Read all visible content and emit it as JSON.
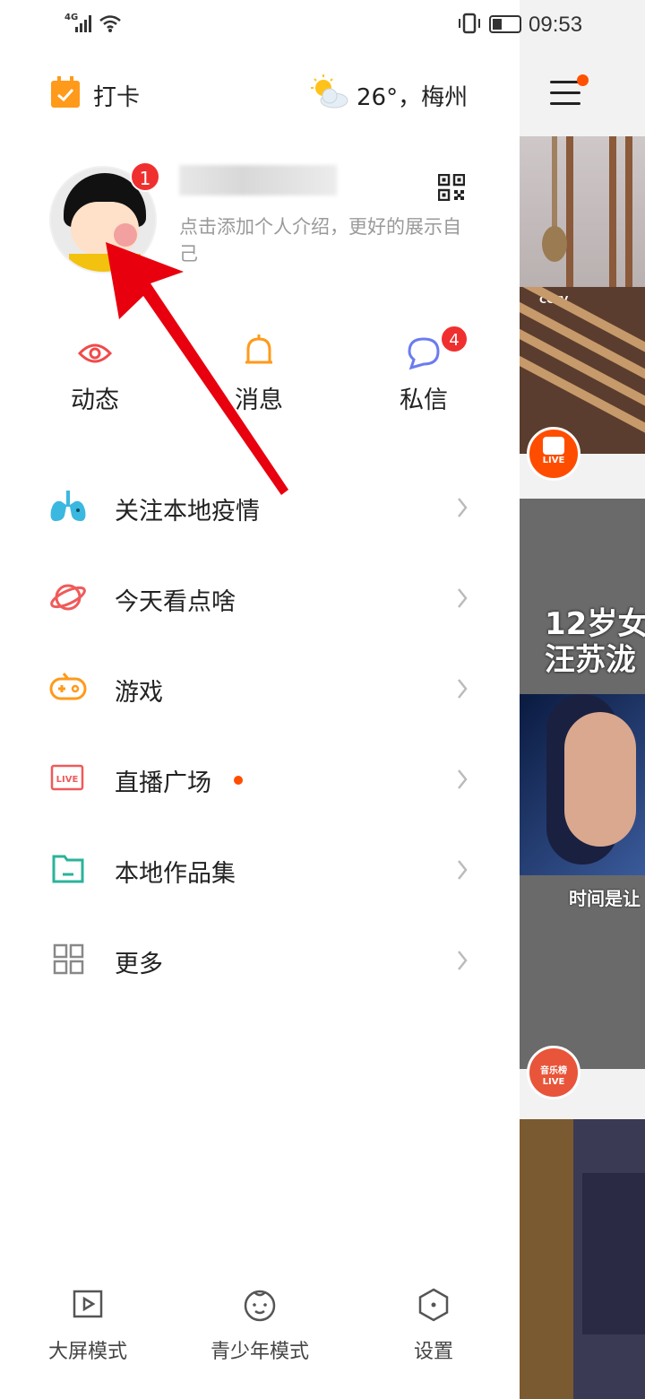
{
  "status_bar": {
    "network": "4G",
    "time": "09:53"
  },
  "top": {
    "checkin_label": "打卡",
    "weather_text": "26°，梅州"
  },
  "profile": {
    "avatar_badge": "1",
    "bio": "点击添加个人介绍，更好的展示自己"
  },
  "quick_actions": [
    {
      "label": "动态",
      "icon": "eye-icon",
      "color": "#f04a4a"
    },
    {
      "label": "消息",
      "icon": "bell-icon",
      "color": "#ff9a1a"
    },
    {
      "label": "私信",
      "icon": "chat-bubble-icon",
      "color": "#6b7cf0",
      "badge": "4"
    }
  ],
  "menu": [
    {
      "label": "关注本地疫情",
      "icon": "lungs-icon",
      "color": "#3ab8e0"
    },
    {
      "label": "今天看点啥",
      "icon": "planet-icon",
      "color": "#f05a5a"
    },
    {
      "label": "游戏",
      "icon": "gamepad-icon",
      "color": "#ff9a1a"
    },
    {
      "label": "直播广场",
      "icon": "live-icon",
      "color": "#f05a5a",
      "has_dot": true
    },
    {
      "label": "本地作品集",
      "icon": "folder-icon",
      "color": "#2bb39a"
    },
    {
      "label": "更多",
      "icon": "grid-icon",
      "color": "#888888"
    }
  ],
  "bottom": [
    {
      "label": "大屏模式",
      "icon": "play-screen-icon"
    },
    {
      "label": "青少年模式",
      "icon": "child-face-icon"
    },
    {
      "label": "设置",
      "icon": "hexagon-settings-icon"
    }
  ],
  "feed": {
    "card2_tag": "CCTV",
    "live_label": "LIVE",
    "card3_title_line1": "12岁女",
    "card3_title_line2": "汪苏泷",
    "card3_subtitle": "时间是让",
    "card3_live_tag": "音乐榜"
  },
  "colors": {
    "accent": "#ff5000",
    "badge": "#f0302f",
    "annotation_arrow": "#e8000f"
  }
}
